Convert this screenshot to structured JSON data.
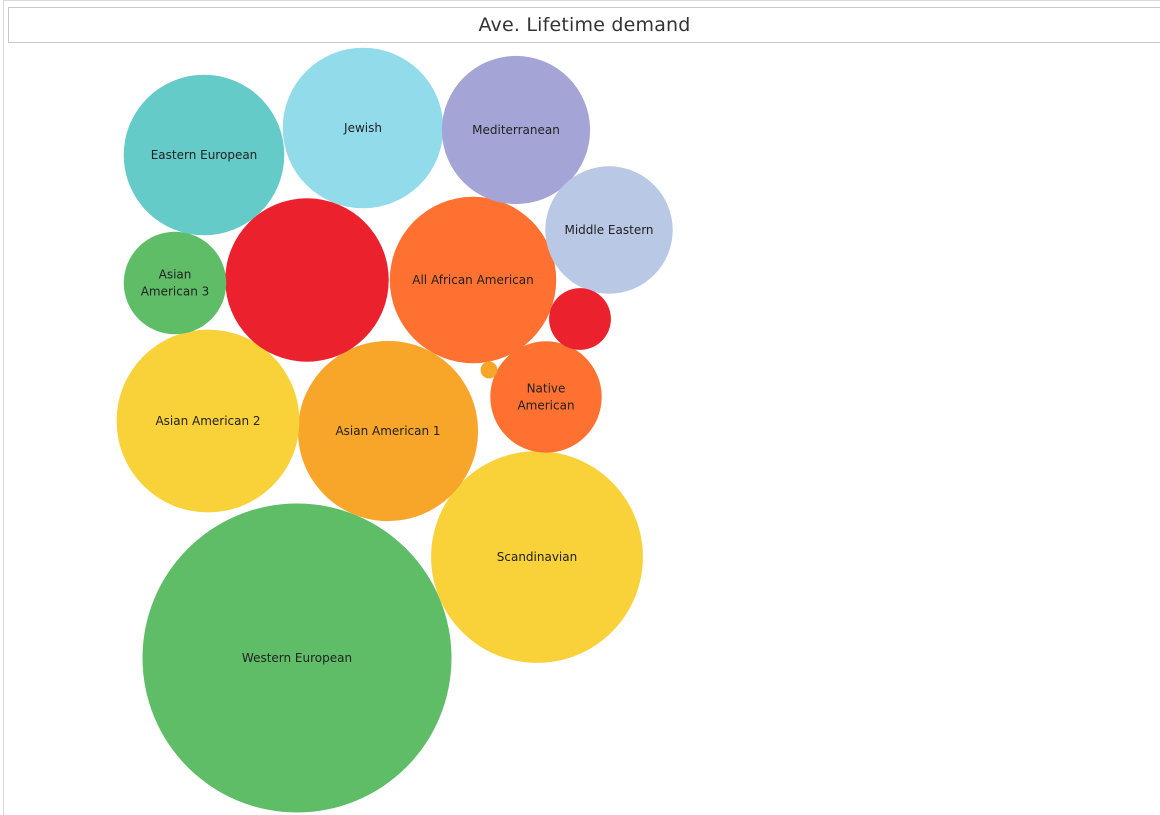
{
  "chart_data": {
    "type": "bubble",
    "title": "Ave. Lifetime demand",
    "bubbles": [
      {
        "label": "Western European",
        "value": 100,
        "color": "#5fbd68"
      },
      {
        "label": "Scandinavian",
        "value": 47,
        "color": "#f9d23a"
      },
      {
        "label": "Asian American 1",
        "value": 34,
        "color": "#f8a62a"
      },
      {
        "label": "Asian American 2",
        "value": 35,
        "color": "#f9d23a"
      },
      {
        "label": "",
        "value": 28,
        "color": "#ec212e"
      },
      {
        "label": "All African American",
        "value": 29,
        "color": "#ff7131"
      },
      {
        "label": "Jewish",
        "value": 27,
        "color": "#91dbea"
      },
      {
        "label": "Eastern European",
        "value": 27,
        "color": "#64cbc8"
      },
      {
        "label": "Mediterranean",
        "value": 23,
        "color": "#a4a5d6"
      },
      {
        "label": "Middle Eastern",
        "value": 17,
        "color": "#b9c8e5"
      },
      {
        "label": "Native American",
        "value": 13,
        "color": "#ff7131"
      },
      {
        "label": "Asian American 3",
        "value": 11,
        "color": "#5fbd68"
      },
      {
        "label": "",
        "value": 4,
        "color": "#ec212e"
      },
      {
        "label": "",
        "value": 0.3,
        "color": "#f8a62a"
      }
    ]
  }
}
